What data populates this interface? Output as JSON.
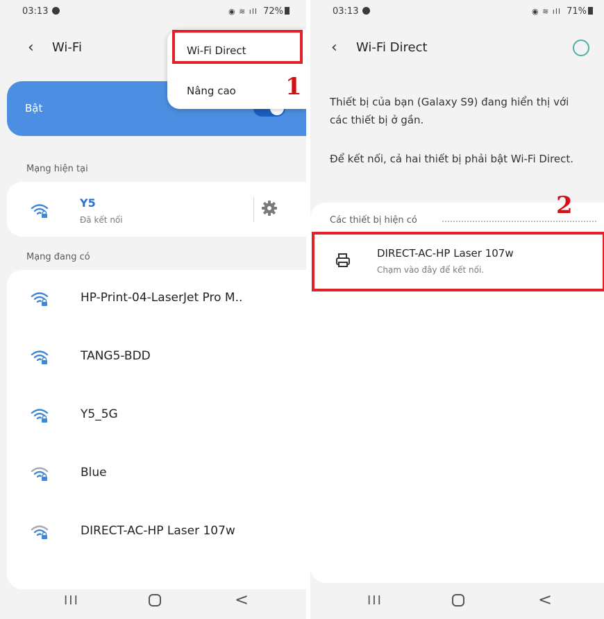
{
  "left": {
    "status": {
      "time": "03:13",
      "battery": "72%"
    },
    "header": {
      "title": "Wi-Fi"
    },
    "toggle_card": {
      "label": "Bật"
    },
    "menu": {
      "items": [
        {
          "label": "Wi-Fi Direct"
        },
        {
          "label": "Nâng cao"
        }
      ]
    },
    "callout": "1",
    "current_section": {
      "label": "Mạng hiện tại",
      "network": {
        "name": "Y5",
        "status": "Đã kết nối"
      }
    },
    "available_section": {
      "label": "Mạng đang có",
      "networks": [
        {
          "name": "HP-Print-04-LaserJet Pro M..",
          "signal": "strong"
        },
        {
          "name": "TANG5-BDD",
          "signal": "strong"
        },
        {
          "name": "Y5_5G",
          "signal": "strong"
        },
        {
          "name": "Blue",
          "signal": "weak"
        },
        {
          "name": "DIRECT-AC-HP Laser 107w",
          "signal": "weak"
        }
      ]
    }
  },
  "right": {
    "status": {
      "time": "03:13",
      "battery": "71%"
    },
    "header": {
      "title": "Wi-Fi Direct"
    },
    "description_1": "Thiết bị của bạn (Galaxy S9) đang hiển thị với các thiết bị ở gần.",
    "description_2": "Để kết nối, cả hai thiết bị phải bật Wi-Fi Direct.",
    "devices_section": {
      "label": "Các thiết bị hiện có",
      "device": {
        "name": "DIRECT-AC-HP Laser 107w",
        "hint": "Chạm vào đây để kết nối."
      }
    },
    "callout": "2"
  },
  "navbar": {
    "recent": "III",
    "back": "<"
  },
  "colors": {
    "accent_blue": "#4c8fe2",
    "toggle_track": "#1a60c2",
    "highlight_red": "#e0222b",
    "callout_red": "#d01218",
    "wifi_blue": "#3d86d8",
    "wifi_grey": "#a8a8a8",
    "refresh_teal": "#4ab1a3"
  },
  "icons": [
    "wifi-lock-icon",
    "gear-icon",
    "printer-icon",
    "back-arrow-icon",
    "refresh-ring-icon",
    "alarm-icon",
    "signal-icon",
    "battery-icon"
  ]
}
